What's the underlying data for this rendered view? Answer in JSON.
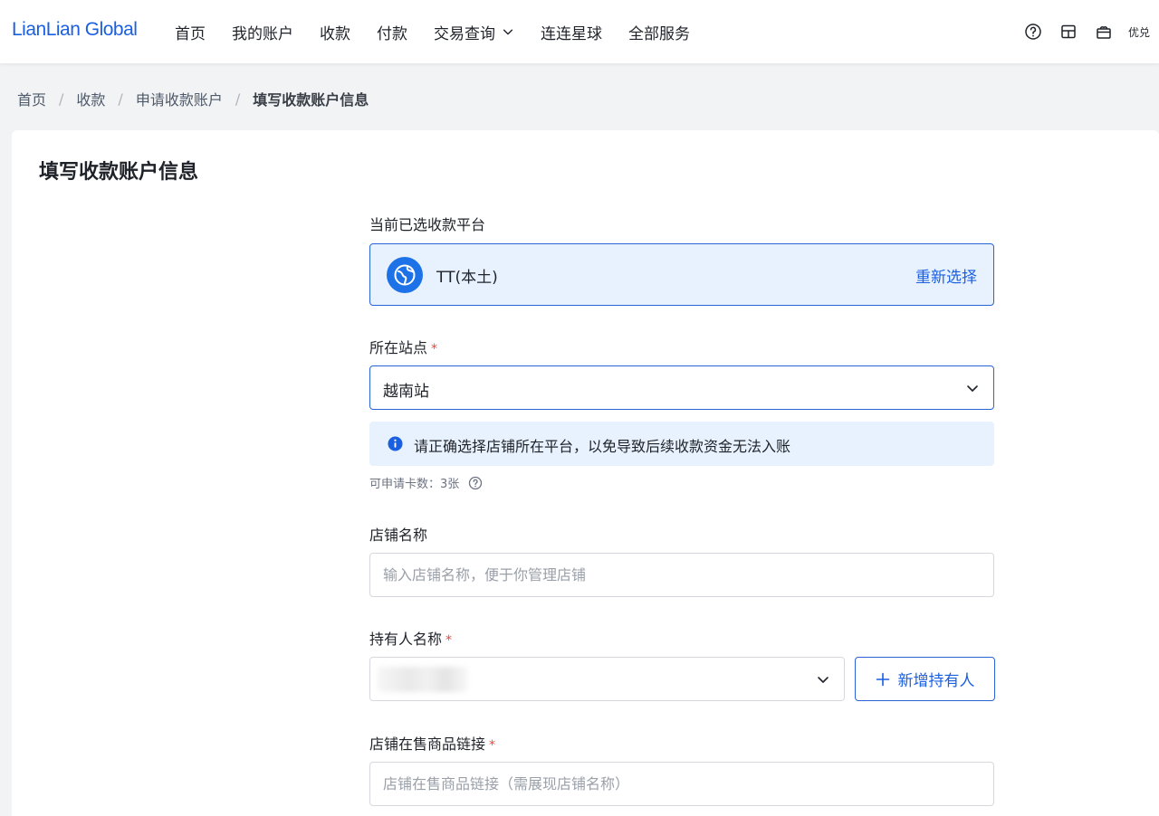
{
  "header": {
    "logo": "LianLian Global",
    "nav": [
      {
        "label": "首页"
      },
      {
        "label": "我的账户"
      },
      {
        "label": "收款"
      },
      {
        "label": "付款"
      },
      {
        "label": "交易查询",
        "has_dropdown": true
      },
      {
        "label": "连连星球"
      },
      {
        "label": "全部服务"
      }
    ],
    "right_icons": [
      "help-icon",
      "calendar-icon",
      "gift-icon"
    ],
    "right_text": "优兑"
  },
  "breadcrumb": [
    "首页",
    "收款",
    "申请收款账户",
    "填写收款账户信息"
  ],
  "page": {
    "title": "填写收款账户信息",
    "platform_section": {
      "label": "当前已选收款平台",
      "platform_name": "TT(本土)",
      "platform_icon": "globe-icon",
      "reselect_label": "重新选择"
    },
    "site_field": {
      "label": "所在站点",
      "required_mark": "*",
      "value": "越南站"
    },
    "info_notice": "请正确选择店铺所在平台，以免导致后续收款资金无法入账",
    "card_quota": "可申请卡数：3张",
    "shop_name_field": {
      "label": "店铺名称",
      "placeholder": "输入店铺名称，便于你管理店铺",
      "value": ""
    },
    "holder_field": {
      "label": "持有人名称",
      "required_mark": "*",
      "add_button": "新增持有人"
    },
    "product_link_field": {
      "label": "店铺在售商品链接",
      "required_mark": "*",
      "placeholder": "店铺在售商品链接（需展现店铺名称）",
      "value": ""
    }
  },
  "colors": {
    "primary": "#1a5fe0",
    "border_active": "#2a62d8",
    "info_bg": "#e8f2fe",
    "required": "#f04438"
  }
}
